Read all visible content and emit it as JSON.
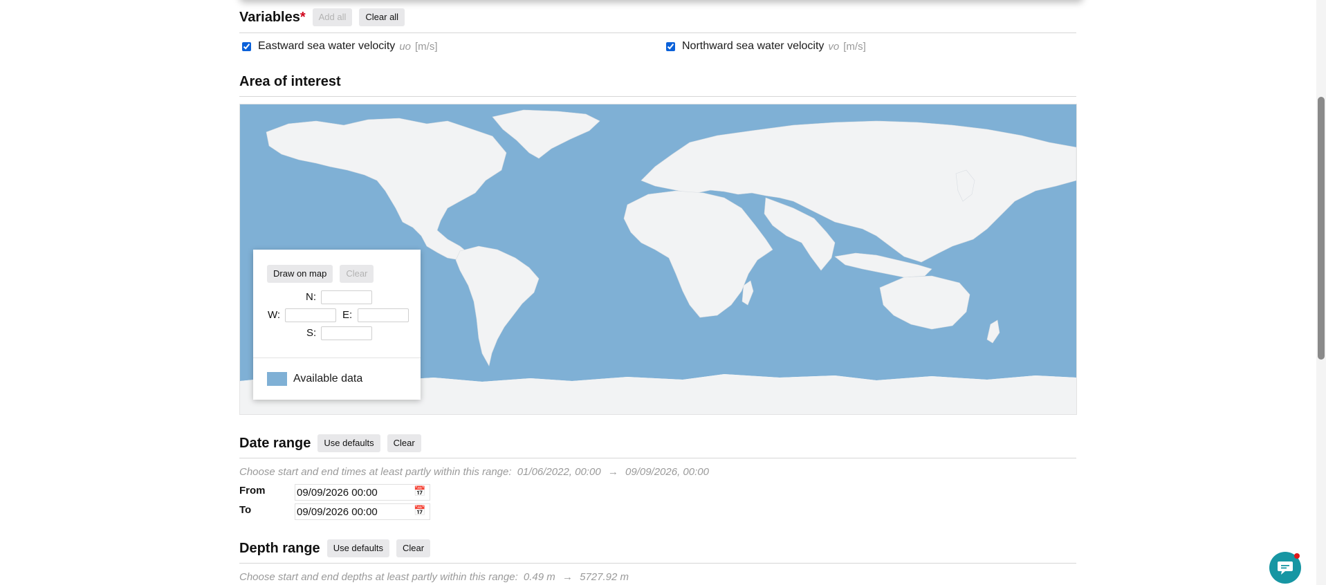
{
  "variables": {
    "title": "Variables",
    "required_mark": "*",
    "add_all": "Add all",
    "clear_all": "Clear all",
    "items": [
      {
        "label": "Eastward sea water velocity",
        "id": "uo",
        "unit": "[m/s]",
        "checked": true
      },
      {
        "label": "Northward sea water velocity",
        "id": "vo",
        "unit": "[m/s]",
        "checked": true
      }
    ]
  },
  "area": {
    "title": "Area of interest",
    "draw_button": "Draw on map",
    "clear_button": "Clear",
    "north_label": "N:",
    "west_label": "W:",
    "east_label": "E:",
    "south_label": "S:",
    "north_value": "",
    "west_value": "",
    "east_value": "",
    "south_value": "",
    "legend_label": "Available data",
    "ocean_color": "#7fb0d5",
    "land_color": "#f2f3f4"
  },
  "date_range": {
    "title": "Date range",
    "use_defaults": "Use defaults",
    "clear": "Clear",
    "hint_prefix": "Choose start and end times at least partly within this range:",
    "range_start": "01/06/2022, 00:00",
    "arrow": "→",
    "range_end": "09/09/2026, 00:00",
    "from_label": "From",
    "to_label": "To",
    "from_value": "09/09/2026 00:00",
    "to_value": "09/09/2026 00:00"
  },
  "depth_range": {
    "title": "Depth range",
    "use_defaults": "Use defaults",
    "clear": "Clear",
    "hint_prefix": "Choose start and end depths at least partly within this range:",
    "range_start": "0.49 m",
    "arrow": "→",
    "range_end": "5727.92 m"
  },
  "colors": {
    "accent": "#0b61d9",
    "chat": "#1796a3",
    "notification": "#e01919"
  },
  "icons": {
    "calendar": "calendar-icon",
    "chat": "chat-icon"
  }
}
